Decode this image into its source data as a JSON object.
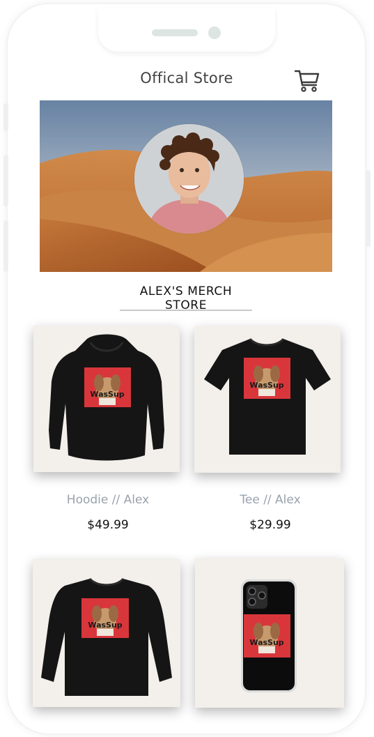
{
  "header": {
    "title": "Offical Store",
    "cart_icon": "shopping-cart-icon"
  },
  "banner": {
    "store_name": "ALEX'S MERCH STORE"
  },
  "products": [
    {
      "name": "Hoodie // Alex",
      "price": "$49.99",
      "print": "WasSup"
    },
    {
      "name": "Tee // Alex",
      "price": "$29.99",
      "print": "WasSup"
    },
    {
      "name": "",
      "price": "",
      "print": "WasSup"
    },
    {
      "name": "",
      "price": "",
      "print": "WasSup"
    }
  ],
  "colors": {
    "garment": "#151515",
    "print_red": "#d9363b",
    "card_bg": "#f3efea",
    "product_name": "#98a3ad"
  }
}
